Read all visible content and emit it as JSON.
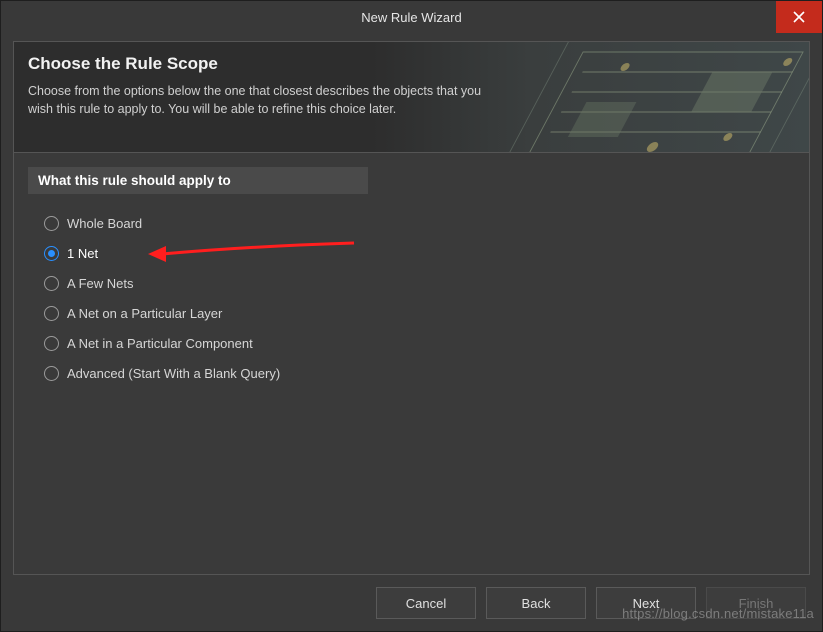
{
  "window": {
    "title": "New Rule Wizard"
  },
  "header": {
    "title": "Choose the Rule Scope",
    "description": "Choose from the options below the one that closest describes the objects that you wish this rule to apply to. You will be able to refine this choice later."
  },
  "section": {
    "label": "What this rule should apply to"
  },
  "scope_options": [
    {
      "label": "Whole Board",
      "selected": false
    },
    {
      "label": "1 Net",
      "selected": true
    },
    {
      "label": "A Few Nets",
      "selected": false
    },
    {
      "label": "A Net on a Particular Layer",
      "selected": false
    },
    {
      "label": "A Net in a Particular Component",
      "selected": false
    },
    {
      "label": "Advanced (Start With a Blank Query)",
      "selected": false
    }
  ],
  "buttons": {
    "cancel": "Cancel",
    "back": "Back",
    "next": "Next",
    "finish": "Finish"
  },
  "watermark": "https://blog.csdn.net/mistake11a"
}
